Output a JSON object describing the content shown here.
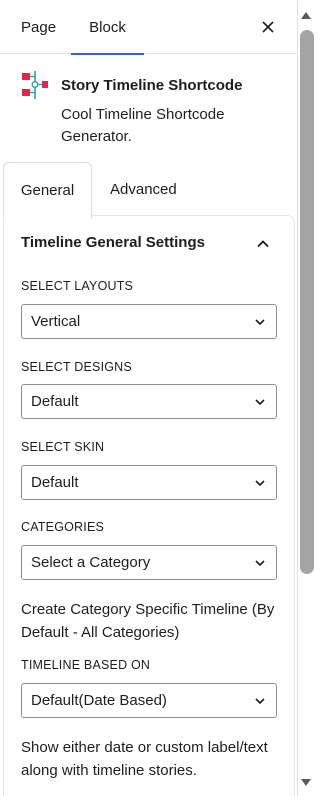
{
  "top_tabs": {
    "page_label": "Page",
    "block_label": "Block"
  },
  "block": {
    "title": "Story Timeline Shortcode",
    "description": "Cool Timeline Shortcode Generator."
  },
  "settings_tabs": {
    "general_label": "General",
    "advanced_label": "Advanced"
  },
  "section": {
    "title": "Timeline General Settings"
  },
  "fields": {
    "layouts": {
      "label": "SELECT LAYOUTS",
      "value": "Vertical"
    },
    "designs": {
      "label": "SELECT DESIGNS",
      "value": "Default"
    },
    "skin": {
      "label": "SELECT SKIN",
      "value": "Default"
    },
    "categories": {
      "label": "CATEGORIES",
      "value": "Select a Category",
      "help": "Create Category Specific Timeline (By Default - All Categories)"
    },
    "based_on": {
      "label": "TIMELINE BASED ON",
      "value": "Default(Date Based)",
      "help": "Show either date or custom label/text along with timeline stories."
    }
  },
  "colors": {
    "accent": "#3858e9",
    "icon_red": "#e2264d",
    "icon_teal": "#2ea2a8"
  },
  "icons": [
    "close-icon",
    "timeline-block-icon",
    "chevron-up-icon",
    "chevron-down-icon",
    "scroll-up-arrow-icon",
    "scroll-down-arrow-icon"
  ]
}
